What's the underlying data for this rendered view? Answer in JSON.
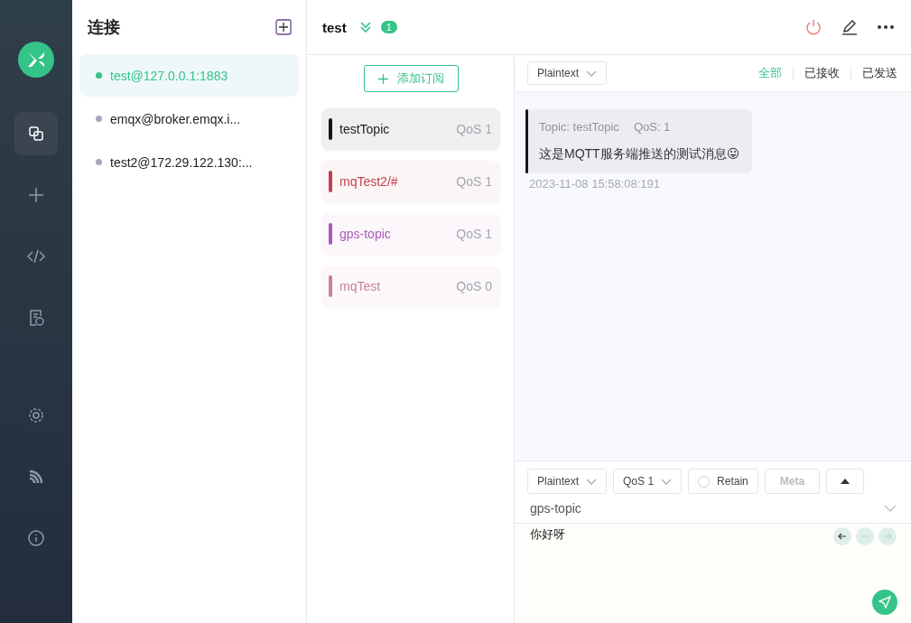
{
  "nav": [
    {
      "kind": "connections",
      "selected": true
    },
    {
      "kind": "new",
      "selected": false
    },
    {
      "kind": "script",
      "selected": false
    },
    {
      "kind": "log",
      "selected": false
    },
    {
      "kind": "settings",
      "selected": false
    },
    {
      "kind": "feed",
      "selected": false
    },
    {
      "kind": "about",
      "selected": false
    }
  ],
  "connections": {
    "title": "连接",
    "items": [
      {
        "name": "test@127.0.0.1:1883",
        "selected": true,
        "color": "#34c388"
      },
      {
        "name": "emqx@broker.emqx.i...",
        "selected": false,
        "color": "#a2a9b8"
      },
      {
        "name": "test2@172.29.122.130:...",
        "selected": false,
        "color": "#a2a9b8"
      }
    ]
  },
  "header": {
    "title": "test",
    "badge": "1"
  },
  "subscriptions": {
    "add_label": "添加订阅",
    "topics": [
      {
        "name": "testTopic",
        "qos": "QoS 1",
        "color": "#1f1414",
        "selected": true
      },
      {
        "name": "mqTest2/#",
        "qos": "QoS 1",
        "color": "#c0414e",
        "selected": false
      },
      {
        "name": "gps-topic",
        "qos": "QoS 1",
        "color": "#a95bb5",
        "selected": false
      },
      {
        "name": "mqTest",
        "qos": "QoS 0",
        "color": "#cc7f98",
        "selected": false
      }
    ]
  },
  "toolbar": {
    "format": "Plaintext",
    "filters": [
      {
        "label": "全部",
        "selected": true
      },
      {
        "label": "已接收",
        "selected": false
      },
      {
        "label": "已发送",
        "selected": false
      }
    ]
  },
  "messages": [
    {
      "topic": "Topic: testTopic",
      "qos": "QoS: 1",
      "payload": "这是MQTT服务端推送的测试消息😛",
      "time": "2023-11-08 15:58:08:191",
      "color": "#1f1414"
    }
  ],
  "composer": {
    "format": "Plaintext",
    "qos": "QoS 1",
    "retain": {
      "label": "Retain",
      "checked": false
    },
    "meta": "Meta",
    "topic": "gps-topic",
    "payload": "你好呀"
  }
}
